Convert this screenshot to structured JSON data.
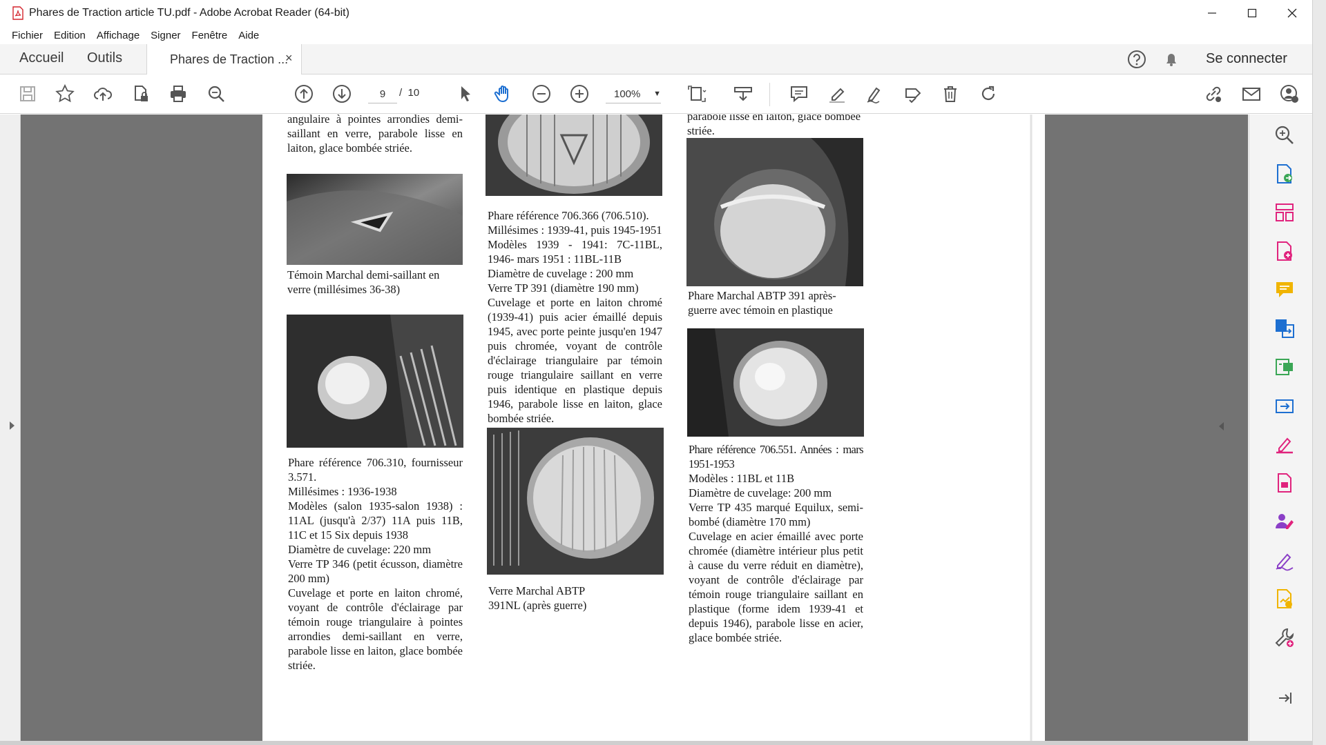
{
  "window": {
    "title": "Phares de Traction article TU.pdf - Adobe Acrobat Reader (64-bit)",
    "minimize_icon": "minimize-icon",
    "maximize_icon": "maximize-icon",
    "close_icon": "close-icon"
  },
  "menu": {
    "items": [
      "Fichier",
      "Edition",
      "Affichage",
      "Signer",
      "Fenêtre",
      "Aide"
    ]
  },
  "tabs": {
    "home": "Accueil",
    "tools": "Outils",
    "document": "Phares de Traction ...",
    "close": "×",
    "signin": "Se connecter"
  },
  "toolbar": {
    "current_page": "9",
    "page_separator": "/",
    "total_pages": "10",
    "zoom": "100%",
    "zoom_caret": "▼"
  },
  "colors": {
    "accent": "#e0237d",
    "blue": "#1d6fd1",
    "green": "#3aa655",
    "yellow": "#f0b400",
    "purple": "#8b3fc7"
  },
  "article": {
    "col1": {
      "top_text": "angulaire à pointes arrondies demi-saillant en verre, parabole lisse en laiton, glace bombée striée.",
      "caption1": "Témoin Marchal demi-saillant en verre (millésimes 36-38)",
      "block2": [
        "Phare référence 706.310, fournisseur 3.571.",
        "Millésimes : 1936-1938",
        "Modèles (salon 1935-salon 1938) : 11AL (jusqu'à 2/37) 11A puis 11B, 11C et 15 Six depuis 1938",
        "Diamètre de cuvelage: 220 mm",
        "Verre TP 346 (petit écusson, diamètre 200 mm)",
        "Cuvelage et porte en laiton chromé, voyant de contrôle d'éclairage par témoin rouge triangulaire à pointes arrondies demi-saillant en verre, parabole lisse en laiton, glace bombée striée."
      ]
    },
    "col2": {
      "block1": [
        "Phare référence 706.366 (706.510).",
        "Millésimes : 1939-41, puis 1945-1951",
        "Modèles 1939 - 1941: 7C-11BL, 1946- mars 1951 : 11BL-11B",
        "Diamètre de cuvelage : 200 mm",
        "Verre TP 391 (diamètre 190 mm)",
        "Cuvelage et porte en laiton chromé (1939-41) puis acier émaillé depuis 1945, avec porte peinte jusqu'en 1947 puis chromée, voyant de contrôle d'éclairage triangulaire par témoin rouge triangulaire saillant en verre puis identique en plastique depuis 1946, parabole lisse en laiton, glace bombée striée."
      ],
      "caption2": "Verre Marchal ABTP 391NL (après guerre)"
    },
    "col3": {
      "top_text": "parabole lisse en laiton, glace bombée striée.",
      "caption1": "Phare Marchal ABTP 391 après-guerre avec témoin en plastique",
      "block2": [
        "Phare référence 706.551. Années : mars 1951-1953",
        "Modèles : 11BL et 11B",
        "Diamètre de cuvelage: 200 mm",
        "Verre TP 435 marqué Equilux, semi-bombé (diamètre 170 mm)",
        "Cuvelage en acier émaillé avec porte chromée (diamètre intérieur plus petit à cause du verre réduit en diamètre), voyant de contrôle d'éclairage par témoin rouge triangulaire saillant en plastique (forme idem 1939-41 et depuis 1946), parabole lisse en acier, glace bombée striée."
      ]
    }
  }
}
